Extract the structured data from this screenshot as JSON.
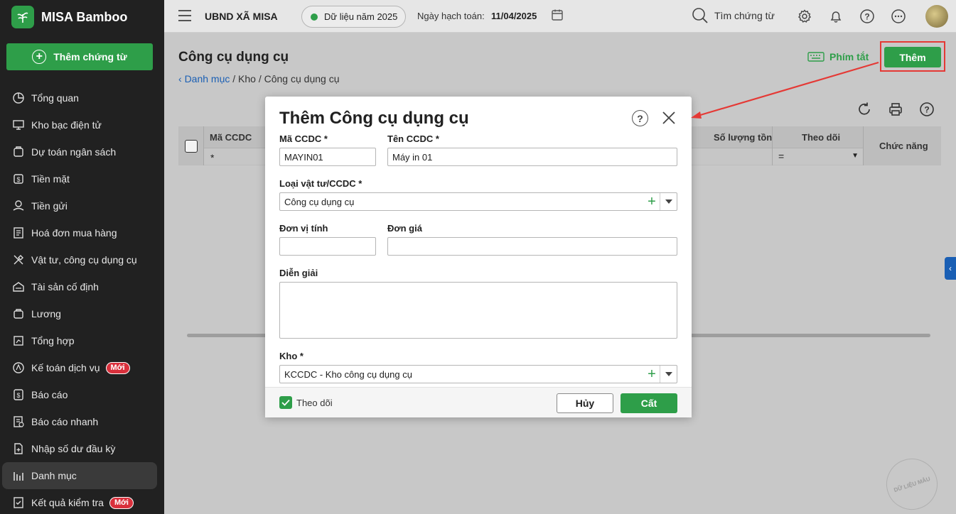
{
  "brand": {
    "name": "MISA Bamboo"
  },
  "sidebar": {
    "add_voucher_label": "Thêm chứng từ",
    "new_badge": "Mới",
    "items": [
      {
        "label": "Tổng quan",
        "icon": "pie-chart-icon"
      },
      {
        "label": "Kho bạc điện tử",
        "icon": "monitor-icon"
      },
      {
        "label": "Dự toán ngân sách",
        "icon": "budget-icon"
      },
      {
        "label": "Tiền mặt",
        "icon": "cash-icon"
      },
      {
        "label": "Tiền gửi",
        "icon": "deposit-icon"
      },
      {
        "label": "Hoá đơn mua hàng",
        "icon": "invoice-icon"
      },
      {
        "label": "Vật tư, công cụ dụng cụ",
        "icon": "tools-icon"
      },
      {
        "label": "Tài sản cố định",
        "icon": "asset-icon"
      },
      {
        "label": "Lương",
        "icon": "salary-icon"
      },
      {
        "label": "Tổng hợp",
        "icon": "summary-icon"
      },
      {
        "label": "Kế toán dịch vụ",
        "icon": "service-icon",
        "badge": true
      },
      {
        "label": "Báo cáo",
        "icon": "report-icon"
      },
      {
        "label": "Báo cáo nhanh",
        "icon": "quick-report-icon"
      },
      {
        "label": "Nhập số dư đầu kỳ",
        "icon": "opening-balance-icon"
      },
      {
        "label": "Danh mục",
        "icon": "catalog-icon",
        "active": true
      },
      {
        "label": "Kết quả kiểm tra",
        "icon": "check-result-icon",
        "badge": true
      }
    ]
  },
  "topbar": {
    "org_name": "UBND XÃ MISA",
    "data_year": "Dữ liệu năm 2025",
    "posting_date_label": "Ngày hạch toán:",
    "posting_date": "11/04/2025",
    "search_label": "Tìm chứng từ"
  },
  "page": {
    "title": "Công cụ dụng cụ",
    "breadcrumb_link": "Danh mục",
    "breadcrumb_rest": " / Kho / Công cụ dụng cụ",
    "shortcut_label": "Phím tắt",
    "add_label": "Thêm"
  },
  "grid": {
    "columns": [
      "Mã CCDC",
      "Số lượng tồn",
      "Theo dõi",
      "Chức năng"
    ],
    "filter_star": "*",
    "filter_eq": "="
  },
  "modal": {
    "title": "Thêm Công cụ dụng cụ",
    "help_glyph": "?",
    "code_label": "Mã CCDC *",
    "code_value": "MAYIN01",
    "name_label": "Tên CCDC *",
    "name_value": "Máy in 01",
    "type_label": "Loại vật tư/CCDC *",
    "type_value": "Công cụ dụng cụ",
    "unit_label": "Đơn vị tính",
    "unit_value": "",
    "price_label": "Đơn giá",
    "price_value": "",
    "desc_label": "Diễn giải",
    "warehouse_label": "Kho *",
    "warehouse_value": "KCCDC - Kho công cụ dụng cụ",
    "track_label": "Theo dõi",
    "track_checked": true,
    "cancel_label": "Hủy",
    "save_label": "Cất"
  },
  "watermark": "DỮ LIỆU MẪU",
  "colors": {
    "accent": "#2e9e49",
    "sidebar_bg": "#212121",
    "link": "#1a5fb4",
    "highlight": "#e53935"
  }
}
